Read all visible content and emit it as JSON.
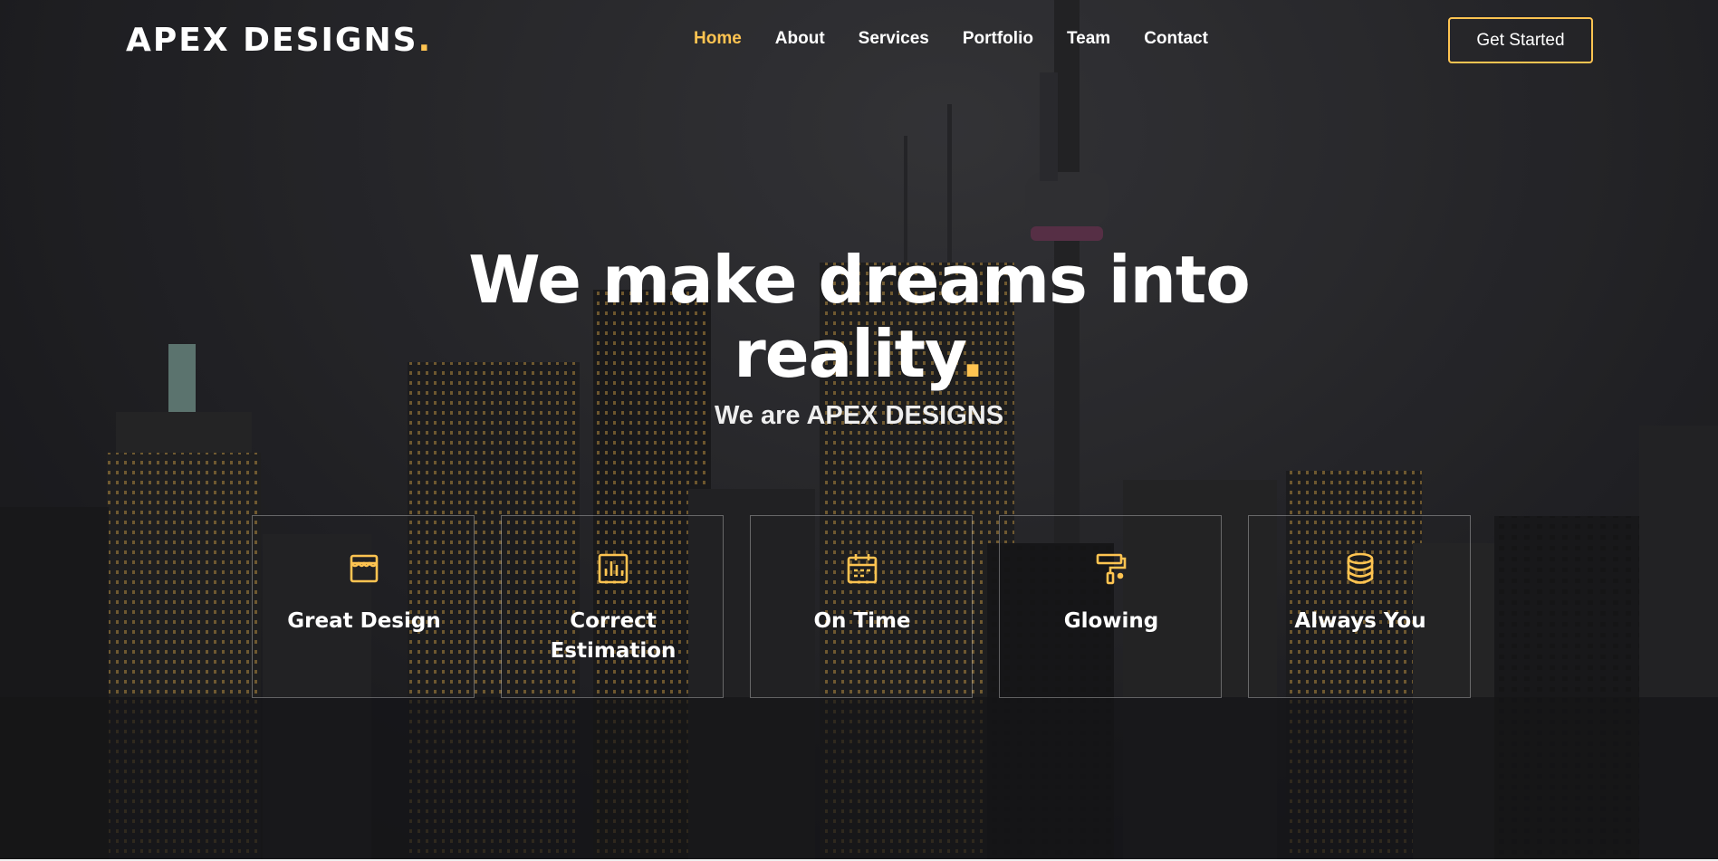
{
  "brand": {
    "name": "APEX DESIGNS",
    "dot": "."
  },
  "nav": {
    "items": [
      {
        "label": "Home",
        "active": true
      },
      {
        "label": "About",
        "active": false
      },
      {
        "label": "Services",
        "active": false
      },
      {
        "label": "Portfolio",
        "active": false
      },
      {
        "label": "Team",
        "active": false
      },
      {
        "label": "Contact",
        "active": false
      }
    ],
    "cta_label": "Get Started"
  },
  "hero": {
    "title": "We make dreams into reality",
    "title_dot": ".",
    "subtitle": "We are APEX DESIGNS"
  },
  "features": [
    {
      "label": "Great Design",
      "icon": "store-icon"
    },
    {
      "label": "Correct Estimation",
      "icon": "bar-chart-icon"
    },
    {
      "label": "On Time",
      "icon": "calendar-icon"
    },
    {
      "label": "Glowing",
      "icon": "paint-roller-icon"
    },
    {
      "label": "Always You",
      "icon": "database-icon"
    }
  ],
  "colors": {
    "accent": "#ffc451",
    "text": "#ffffff",
    "background": "#2b2b2f"
  }
}
